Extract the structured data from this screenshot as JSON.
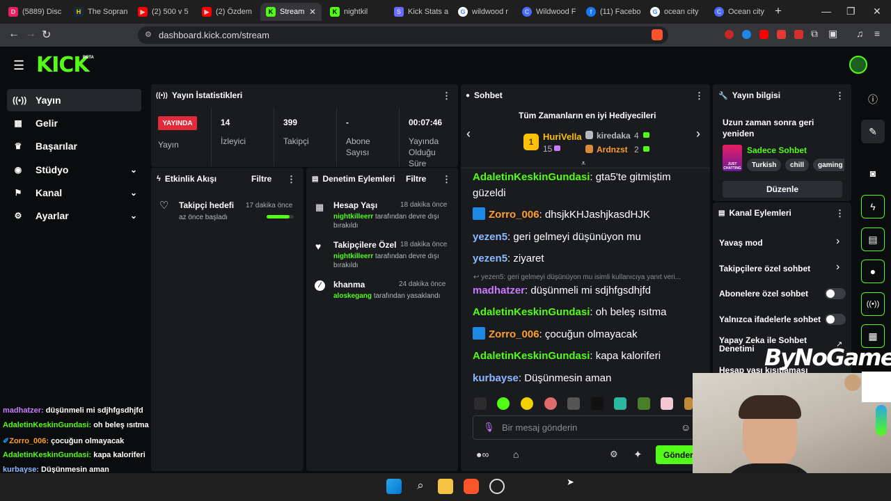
{
  "tabs": [
    {
      "title": "(5889) Disc",
      "fav": "D",
      "color": "#5865f2"
    },
    {
      "title": "The Sopran",
      "fav": "H",
      "color": "#1a2a3a"
    },
    {
      "title": "(2) 500 v 5",
      "fav": "▶",
      "color": "#ff0000"
    },
    {
      "title": "(2) Özdem",
      "fav": "▶",
      "color": "#ff0000"
    },
    {
      "title": "Stream",
      "fav": "K",
      "color": "#53fc18"
    },
    {
      "title": "nightkil",
      "fav": "K",
      "color": "#53fc18"
    },
    {
      "title": "Kick Stats a",
      "fav": "S",
      "color": "#6b6bff"
    },
    {
      "title": "wildwood r",
      "fav": "G",
      "color": "#4285f4"
    },
    {
      "title": "Wildwood F",
      "fav": "C",
      "color": "#4a6cf7"
    },
    {
      "title": "(11) Facebo",
      "fav": "f",
      "color": "#1877f2"
    },
    {
      "title": "ocean city",
      "fav": "G",
      "color": "#4285f4"
    },
    {
      "title": "Ocean city",
      "fav": "C",
      "color": "#4a6cf7"
    }
  ],
  "address_bar": {
    "url": "dashboard.kick.com/stream"
  },
  "brand": {
    "name": "KICK",
    "badge": "BETA",
    "accent": "#53fc18"
  },
  "sidebar": {
    "items": [
      {
        "label": "Yayın",
        "icon": "broadcast-icon"
      },
      {
        "label": "Gelir",
        "icon": "revenue-icon"
      },
      {
        "label": "Başarılar",
        "icon": "trophy-icon"
      },
      {
        "label": "Stüdyo",
        "icon": "studio-icon"
      },
      {
        "label": "Kanal",
        "icon": "channel-icon"
      },
      {
        "label": "Ayarlar",
        "icon": "gear-icon"
      }
    ]
  },
  "stats": {
    "title": "Yayın İstatistikleri",
    "live_badge": "YAYINDA",
    "stream_label": "Yayın",
    "viewers": {
      "value": "14",
      "label": "İzleyici"
    },
    "followers": {
      "value": "399",
      "label": "Takipçi"
    },
    "subs": {
      "value": "-",
      "label": "Abone Sayısı"
    },
    "duration": {
      "value": "00:07:46",
      "label": "Yayında Olduğu Süre"
    }
  },
  "activity": {
    "title": "Etkinlik Akışı",
    "filter": "Filtre",
    "items": [
      {
        "title": "Takipçi hedefi",
        "time": "17 dakika önce",
        "sub": "az önce başladı",
        "progress": 0.85
      }
    ]
  },
  "moderation": {
    "title": "Denetim Eylemleri",
    "filter": "Filtre",
    "items": [
      {
        "title": "Hesap Yaşı",
        "time": "18 dakika önce",
        "user": "nightkilleerr",
        "sub": "tarafından devre dışı bırakıldı"
      },
      {
        "title": "Takipçilere Özel",
        "time": "18 dakika önce",
        "user": "nightkilleerr",
        "sub": "tarafından devre dışı bırakıldı"
      },
      {
        "title": "khanma",
        "time": "24 dakika önce",
        "user": "aloskegang",
        "sub": "tarafından yasaklandı"
      }
    ]
  },
  "chat": {
    "title": "Sohbet",
    "gifters_title": "Tüm Zamanların en iyi Hediyecileri",
    "gifters": [
      {
        "name": "HuriVella",
        "count": "15",
        "rank": "1"
      },
      {
        "name": "kiredaka",
        "count": "4"
      },
      {
        "name": "Ardnzst",
        "count": "2"
      }
    ],
    "messages": [
      {
        "user": "AdaletinKeskinGundasi",
        "text": "gta5'te gitmiştim güzeldi",
        "color": "green"
      },
      {
        "user": "Zorro_006",
        "text": "dhsjkKHJashjkasdHJK",
        "color": "orange"
      },
      {
        "user": "yezen5",
        "text": "geri gelmeyi düşünüyon mu",
        "color": "blue"
      },
      {
        "user": "yezen5",
        "text": "ziyaret",
        "color": "blue"
      },
      {
        "reply": "yezen5: geri gelmeyi düşünüyon mu isimli kullanıcıya yanıt veri..."
      },
      {
        "user": "madhatzer",
        "text": "düşünmeli mi sdjhfgsdhjfd",
        "color": "purple"
      },
      {
        "user": "AdaletinKeskinGundasi",
        "text": "oh beleş ısıtma",
        "color": "green"
      },
      {
        "user": "Zorro_006",
        "text": "çocuğun olmayacak",
        "color": "orange"
      },
      {
        "user": "AdaletinKeskinGundasi",
        "text": "kapa kaloriferi",
        "color": "green"
      },
      {
        "user": "kurbayse",
        "text": "Düşünmesin aman",
        "color": "blue"
      }
    ],
    "input_placeholder": "Bir mesaj gönderin",
    "send_label": "Gönder"
  },
  "stream_info": {
    "title": "Yayın bilgisi",
    "stream_title": "Uzun zaman sonra geri yeniden",
    "category": "Sadece Sohbet",
    "category_art": "JUST CHATTING",
    "tags": [
      "Turkish",
      "chill",
      "gaming"
    ],
    "edit_label": "Düzenle"
  },
  "channel_actions": {
    "title": "Kanal Eylemleri",
    "items": [
      {
        "label": "Yavaş mod",
        "type": "link"
      },
      {
        "label": "Takipçilere özel sohbet",
        "type": "link"
      },
      {
        "label": "Abonelere özel sohbet",
        "type": "toggle"
      },
      {
        "label": "Yalnızca ifadelerle sohbet",
        "type": "toggle"
      },
      {
        "label": "Yapay Zeka ile Sohbet Denetimi",
        "type": "external"
      },
      {
        "label": "Hesap yaşı kısıtlaması",
        "type": "link"
      }
    ]
  },
  "overlay": {
    "watermark": "ByNoGame",
    "messages": [
      {
        "user": "madhatzer:",
        "text": "düşünmeli mi sdjhfgsdhjfd",
        "color": "#c97cff"
      },
      {
        "user": "AdaletinKeskinGundasi:",
        "text": "oh beleş ısıtma",
        "color": "#53fc18"
      },
      {
        "user": "Zorro_006:",
        "text": "çocuğun olmayacak",
        "color": "#ff9e2c"
      },
      {
        "user": "AdaletinKeskinGundasi:",
        "text": "kapa kaloriferi",
        "color": "#53fc18"
      },
      {
        "user": "kurbayse:",
        "text": "Düşünmesin aman",
        "color": "#8cb9ff"
      }
    ]
  }
}
